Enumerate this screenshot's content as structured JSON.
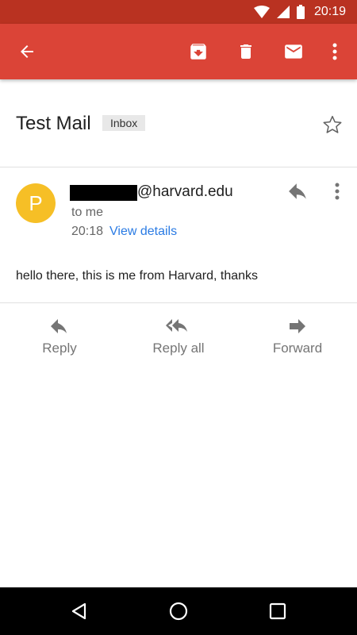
{
  "status_bar": {
    "time": "20:19",
    "icons": [
      "wifi-icon",
      "signal-icon",
      "battery-icon"
    ]
  },
  "toolbar": {
    "back_icon": "back-arrow-icon",
    "actions": [
      "archive-icon",
      "delete-icon",
      "mark-unread-icon",
      "more-icon"
    ],
    "color": "#db4437"
  },
  "email": {
    "subject": "Test Mail",
    "label": "Inbox",
    "sender": {
      "avatar_letter": "P",
      "avatar_color": "#f6bf26",
      "address_domain": "@harvard.edu"
    },
    "recipient": "to me",
    "time": "20:18",
    "view_details": "View details",
    "body": "hello there, this is me from Harvard, thanks"
  },
  "actions": {
    "reply": "Reply",
    "reply_all": "Reply all",
    "forward": "Forward"
  },
  "nav_bar": {
    "icons": [
      "back-triangle-icon",
      "home-circle-icon",
      "recents-square-icon"
    ]
  }
}
